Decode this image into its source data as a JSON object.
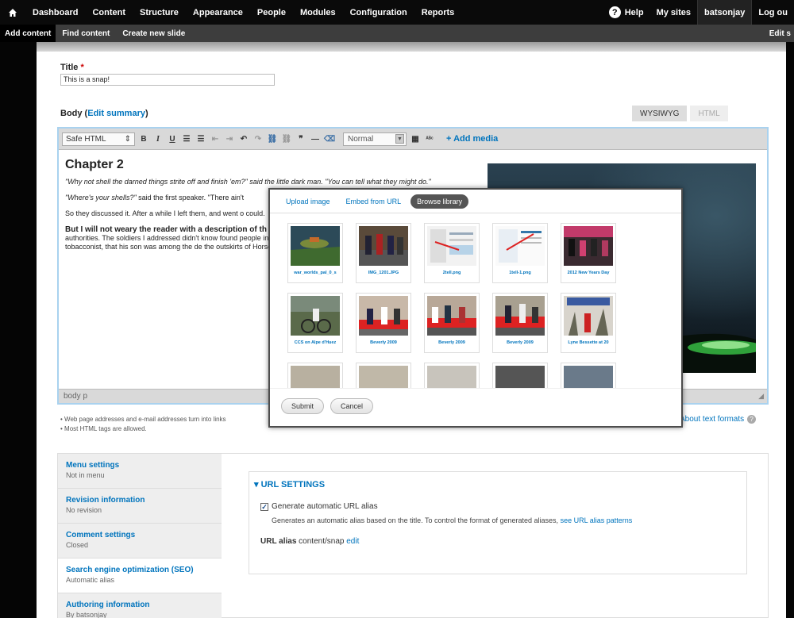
{
  "toolbar": {
    "menu": [
      "Dashboard",
      "Content",
      "Structure",
      "Appearance",
      "People",
      "Modules",
      "Configuration",
      "Reports"
    ],
    "help": "Help",
    "my_sites": "My sites",
    "user": "batsonjay",
    "logout": "Log ou"
  },
  "shortcuts": {
    "items": [
      "Add content",
      "Find content",
      "Create new slide"
    ],
    "edit": "Edit s"
  },
  "form": {
    "title_label": "Title",
    "required_mark": "*",
    "title_value": "This is a snap!",
    "body_label": "Body",
    "edit_summary": "Edit summary"
  },
  "editor": {
    "tabs": [
      "WYSIWYG",
      "HTML"
    ],
    "format": "Safe HTML",
    "style": "Normal",
    "add_media": "+ Add media",
    "status_path": "body  p",
    "heading": "Chapter 2",
    "p1": "\"Why not shell the darned things strite off and finish 'em?\" said the little dark man. \"You can tell what they might do.\"",
    "p2_quote": "\"Where's your shells?\"",
    "p2_rest": " said the first speaker. \"There ain't",
    "p3": "So they discussed it. After a while I left them, and went o could.",
    "p4_bold": "But I will not weary the reader with a description of th",
    "p4_rest": " succeed in getting a glimpse of the common, for even H military authorities. The soldiers I addressed didn't know found people in the town quite secure again in the prese Marshall, the tobacconist, that his son was among the de the outskirts of Horsell lock up and leave their houses."
  },
  "format_tips": [
    "Web page addresses and e-mail addresses turn into links",
    "Most HTML tags are allowed."
  ],
  "about_formats": "About text formats",
  "vtabs": [
    {
      "title": "Menu settings",
      "summary": "Not in menu"
    },
    {
      "title": "Revision information",
      "summary": "No revision"
    },
    {
      "title": "Comment settings",
      "summary": "Closed"
    },
    {
      "title": "Search engine optimization (SEO)",
      "summary": "Automatic alias"
    },
    {
      "title": "Authoring information",
      "summary": "By batsonjay"
    }
  ],
  "url_settings": {
    "legend": "▾ URL SETTINGS",
    "checkbox_label": "Generate automatic URL alias",
    "description": "Generates an automatic alias based on the title. To control the format of generated aliases,",
    "patterns_link": "see URL alias patterns",
    "alias_label": "URL alias",
    "alias_value": "content/snap",
    "alias_edit": "edit"
  },
  "media_dialog": {
    "tabs": [
      "Upload image",
      "Embed from URL",
      "Browse library"
    ],
    "thumbs": [
      "war_worlds_pal_0_s",
      "IMG_1201.JPG",
      "2tell.png",
      "1tell-1.png",
      "2012 New Years Day",
      "CCS on Alpe d'Huez",
      "Beverly 2009",
      "Beverly 2009",
      "Beverly 2009",
      "Lyne Bessette at 20"
    ],
    "submit": "Submit",
    "cancel": "Cancel"
  },
  "colors": {
    "link": "#0074bd",
    "toolbar_bg": "#0a0a0a",
    "editor_border": "#a9d2ef"
  }
}
